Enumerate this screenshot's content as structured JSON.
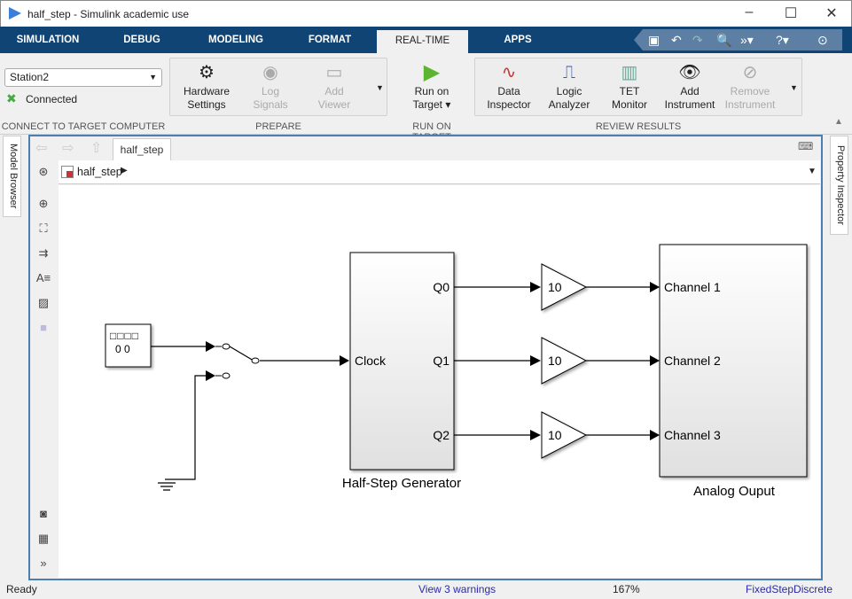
{
  "window": {
    "title": "half_step - Simulink academic use",
    "minimize": "–",
    "maximize": "☐",
    "close": "✕"
  },
  "tabs": [
    {
      "label": "SIMULATION"
    },
    {
      "label": "DEBUG"
    },
    {
      "label": "MODELING"
    },
    {
      "label": "FORMAT"
    },
    {
      "label": "REAL-TIME",
      "active": true
    },
    {
      "label": "APPS"
    }
  ],
  "quick_access": [
    "save-icon",
    "undo-icon",
    "redo-icon",
    "search-icon",
    "shortcut-icon",
    "help-icon",
    "collapse-icon"
  ],
  "ribbon": {
    "connect": {
      "target": "Station2",
      "status": "Connected",
      "section": "CONNECT TO TARGET COMPUTER"
    },
    "prepare": {
      "section": "PREPARE",
      "buttons": [
        {
          "label1": "Hardware",
          "label2": "Settings"
        },
        {
          "label1": "Log",
          "label2": "Signals",
          "disabled": true
        },
        {
          "label1": "Add",
          "label2": "Viewer",
          "disabled": true
        }
      ]
    },
    "run": {
      "section": "RUN ON TARGET",
      "label1": "Run on",
      "label2": "Target ▾"
    },
    "review": {
      "section": "REVIEW RESULTS",
      "buttons": [
        {
          "label1": "Data",
          "label2": "Inspector"
        },
        {
          "label1": "Logic",
          "label2": "Analyzer"
        },
        {
          "label1": "TET",
          "label2": "Monitor"
        },
        {
          "label1": "Add",
          "label2": "Instrument"
        },
        {
          "label1": "Remove",
          "label2": "Instrument",
          "disabled": true
        }
      ]
    }
  },
  "side_tabs": {
    "left": "Model Browser",
    "right": "Property Inspector"
  },
  "editor": {
    "tab": "half_step",
    "breadcrumb": "half_step"
  },
  "diagram": {
    "clock_display": "□□□□",
    "clock_digits": "0 0",
    "generator": {
      "name": "Half-Step Generator",
      "input": "Clock",
      "outputs": [
        "Q0",
        "Q1",
        "Q2"
      ]
    },
    "gains": [
      "10",
      "10",
      "10"
    ],
    "output": {
      "name": "Analog Ouput",
      "inputs": [
        "Channel 1",
        "Channel 2",
        "Channel 3"
      ]
    }
  },
  "status": {
    "state": "Ready",
    "warnings": "View 3 warnings",
    "zoom": "167%",
    "solver": "FixedStepDiscrete"
  }
}
